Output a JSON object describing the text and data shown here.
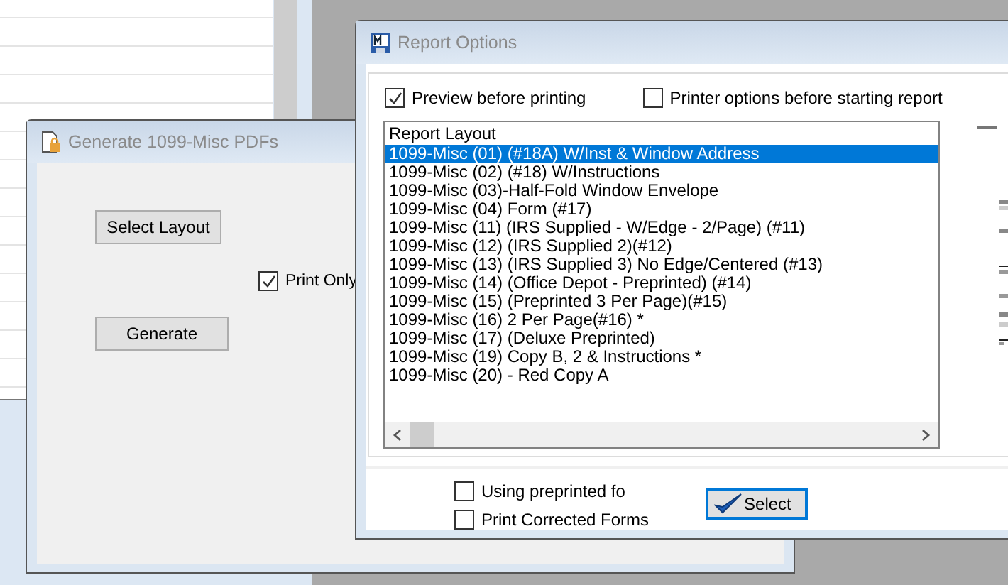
{
  "generate_window": {
    "title": "Generate 1099-Misc PDFs",
    "buttons": [
      "Select Layout",
      "Generate"
    ],
    "print_only": {
      "label": "Print Only",
      "checked": true
    }
  },
  "report_options": {
    "title": "Report Options",
    "options": [
      {
        "label": "Preview before printing",
        "checked": true
      },
      {
        "label": "Printer options before starting report",
        "checked": false
      }
    ],
    "list": {
      "header": "Report Layout",
      "items": [
        {
          "label": "1099-Misc (01) (#18A) W/Inst & Window Address",
          "selected": true
        },
        {
          "label": "1099-Misc (02) (#18) W/Instructions",
          "selected": false
        },
        {
          "label": "1099-Misc (03)-Half-Fold Window Envelope",
          "selected": false
        },
        {
          "label": "1099-Misc (04) Form (#17)",
          "selected": false
        },
        {
          "label": "1099-Misc (11)  (IRS Supplied - W/Edge - 2/Page) (#11)",
          "selected": false
        },
        {
          "label": "1099-Misc (12) (IRS Supplied 2)(#12)",
          "selected": false
        },
        {
          "label": "1099-Misc (13) (IRS Supplied 3) No Edge/Centered (#13)",
          "selected": false
        },
        {
          "label": "1099-Misc (14) (Office Depot - Preprinted) (#14)",
          "selected": false
        },
        {
          "label": "1099-Misc (15) (Preprinted 3 Per Page)(#15)",
          "selected": false
        },
        {
          "label": "1099-Misc (16) 2 Per Page(#16) *",
          "selected": false
        },
        {
          "label": "1099-Misc (17) (Deluxe Preprinted)",
          "selected": false
        },
        {
          "label": "1099-Misc (19) Copy B, 2 & Instructions *",
          "selected": false
        },
        {
          "label": "1099-Misc (20) - Red Copy A",
          "selected": false
        }
      ]
    },
    "bottom_options": [
      {
        "label": "Using preprinted fo",
        "checked": false
      },
      {
        "label": "Print Corrected Forms",
        "checked": false
      }
    ],
    "select_button": "Select"
  }
}
